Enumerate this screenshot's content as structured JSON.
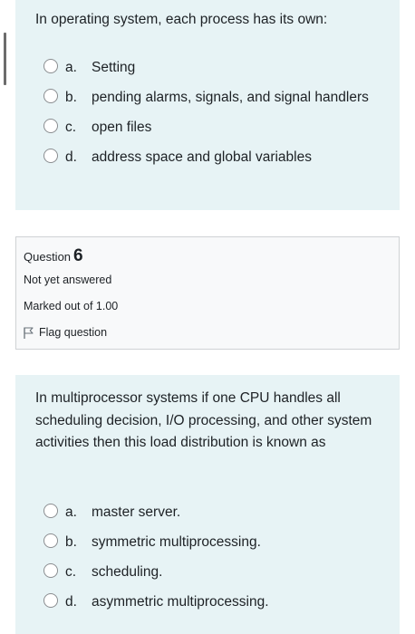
{
  "previous_question": {
    "text": "In operating system, each process has its own:",
    "answers": [
      {
        "letter": "a.",
        "text": "Setting"
      },
      {
        "letter": "b.",
        "text": "pending alarms, signals, and signal handlers"
      },
      {
        "letter": "c.",
        "text": "open files"
      },
      {
        "letter": "d.",
        "text": "address space and global variables"
      }
    ]
  },
  "question_info": {
    "label": "Question",
    "number": "6",
    "state": "Not yet answered",
    "grade": "Marked out of 1.00",
    "flag_label": "Flag question",
    "flag_icon": "flag-icon"
  },
  "current_question": {
    "text": "In multiprocessor systems if one CPU handles all scheduling decision, I/O processing, and other system activities then this load distribution is known as",
    "answers": [
      {
        "letter": "a.",
        "text": "master server."
      },
      {
        "letter": "b.",
        "text": "symmetric multiprocessing."
      },
      {
        "letter": "c.",
        "text": "scheduling."
      },
      {
        "letter": "d.",
        "text": "asymmetric multiprocessing."
      }
    ]
  },
  "colors": {
    "question_background": "#e7f3f5",
    "info_background": "#f8f9fa",
    "info_border": "#cfd2d4",
    "text": "#1d2125"
  }
}
